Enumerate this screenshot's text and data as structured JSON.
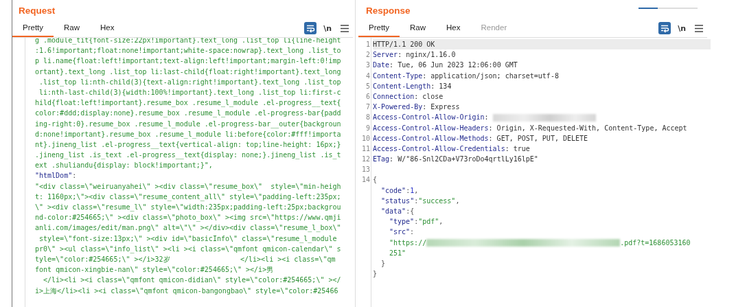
{
  "request": {
    "title": "Request",
    "tabs": [
      {
        "label": "Pretty",
        "selected": true,
        "disabled": false
      },
      {
        "label": "Raw",
        "selected": false,
        "disabled": false
      },
      {
        "label": "Hex",
        "selected": false,
        "disabled": false
      }
    ],
    "toolbar": [
      {
        "kind": "wrap",
        "selected": true
      },
      {
        "kind": "newline",
        "label": "\\n"
      },
      {
        "kind": "menu"
      }
    ],
    "rows": [
      {
        "segments": [
          {
            "kind": "string",
            "text": "g .module_tit{font-size:22px!important}.text_long .list_top li{line-height"
          }
        ]
      },
      {
        "segments": [
          {
            "kind": "string",
            "text": ":1.6!important;float:none!important;white-space:nowrap}.text_long .list_to"
          }
        ]
      },
      {
        "segments": [
          {
            "kind": "string",
            "text": "p li.name{float:left!important;text-align:left!important;margin-left:0!imp"
          }
        ]
      },
      {
        "segments": [
          {
            "kind": "string",
            "text": "ortant}.text_long .list_top li:last-child{float:right!important}.text_long"
          }
        ]
      },
      {
        "segments": [
          {
            "kind": "string",
            "text": " .list_top li:nth-child(3){text-align:right!important}.text_long .list_top"
          }
        ]
      },
      {
        "segments": [
          {
            "kind": "string",
            "text": " li:nth-last-child(3){width:100%!important}.text_long .list_top li:first-c"
          }
        ]
      },
      {
        "segments": [
          {
            "kind": "string",
            "text": "hild{float:left!important}.resume_box .resume_l_module .el-progress__text{"
          }
        ]
      },
      {
        "segments": [
          {
            "kind": "string",
            "text": "color:#ddd;display:none}.resume_box .resume_l_module .el-progress-bar{padd"
          }
        ]
      },
      {
        "segments": [
          {
            "kind": "string",
            "text": "ing-right:0}.resume_box .resume_l_module .el-progress-bar__outer{backgroun"
          }
        ]
      },
      {
        "segments": [
          {
            "kind": "string",
            "text": "d:none!important}.resume_box .resume_l_module li:before{color:#fff!importa"
          }
        ]
      },
      {
        "segments": [
          {
            "kind": "string",
            "text": "nt}.jineng_list .el-progress__text{vertical-align: top;line-height: 16px;}"
          }
        ]
      },
      {
        "segments": [
          {
            "kind": "string",
            "text": ".jineng_list .is_text .el-progress__text{display: none;}.jineng_list .is_t"
          }
        ]
      },
      {
        "segments": [
          {
            "kind": "string",
            "text": "ext .shuliandu{display: block!important;}\","
          }
        ]
      },
      {
        "segments": [
          {
            "kind": "key",
            "text": "\"htmlDom\""
          },
          {
            "kind": "punct",
            "text": ":"
          }
        ]
      },
      {
        "segments": [
          {
            "kind": "string",
            "text": "\"<div class=\\\"weiruanyahei\\\" ><div class=\\\"resume_box\\\"  style=\\\"min-heigh"
          }
        ]
      },
      {
        "segments": [
          {
            "kind": "string",
            "text": "t: 1160px;\\\"><div class=\\\"resume_content_all\\\" style=\\\"padding-left:235px;"
          }
        ]
      },
      {
        "segments": [
          {
            "kind": "string",
            "text": "\\\" ><div class=\\\"resume_l\\\" style=\\\"width:235px;padding-left:25px;backgrou"
          }
        ]
      },
      {
        "segments": [
          {
            "kind": "string",
            "text": "nd-color:#254665;\\\" ><div class=\\\"photo_box\\\" ><img src=\\\"https://www.qmji"
          }
        ]
      },
      {
        "segments": [
          {
            "kind": "string",
            "text": "anli.com/images/edit/man.png\\\" alt=\\\"\\\" ></div><div class=\\\"resume_l_box\\\""
          }
        ]
      },
      {
        "segments": [
          {
            "kind": "string",
            "text": " style=\\\"font-size:13px;\\\" ><div id=\\\"basicInfo\\\" class=\\\"resume_l_module"
          }
        ]
      },
      {
        "segments": [
          {
            "kind": "string",
            "text": "pr0\\\" ><ul class=\\\"info_list\\\" ><li ><i class=\\\"qmfont qmicon-calendar\\\" s"
          }
        ]
      },
      {
        "segments": [
          {
            "kind": "string",
            "text": "tyle=\\\"color:#254665;\\\" ></i>32岁                 </li><li ><i class=\\\"qm"
          }
        ]
      },
      {
        "segments": [
          {
            "kind": "string",
            "text": "font qmicon-xingbie-nan\\\" style=\\\"color:#254665;\\\" ></i>男"
          }
        ]
      },
      {
        "segments": [
          {
            "kind": "string",
            "text": "  </li><li ><i class=\\\"qmfont qmicon-didian\\\" style=\\\"color:#254665;\\\" ></"
          }
        ]
      },
      {
        "segments": [
          {
            "kind": "string",
            "text": "i>上海</li><li ><i class=\\\"qmfont qmicon-bangongbao\\\" style=\\\"color:#25466"
          }
        ]
      }
    ]
  },
  "response": {
    "title": "Response",
    "tabs": [
      {
        "label": "Pretty",
        "selected": true,
        "disabled": false
      },
      {
        "label": "Raw",
        "selected": false,
        "disabled": false
      },
      {
        "label": "Hex",
        "selected": false,
        "disabled": false
      },
      {
        "label": "Render",
        "selected": false,
        "disabled": true
      }
    ],
    "toolbar": [
      {
        "kind": "wrap",
        "selected": true
      },
      {
        "kind": "newline",
        "label": "\\n"
      },
      {
        "kind": "menu"
      }
    ],
    "rows": [
      {
        "number": "1",
        "current": true,
        "segments": [
          {
            "kind": "plain",
            "text": "HTTP/1.1 200 OK"
          }
        ]
      },
      {
        "number": "2",
        "current": false,
        "segments": [
          {
            "kind": "key",
            "text": "Server"
          },
          {
            "kind": "plain",
            "text": ": nginx/1.16.0"
          }
        ]
      },
      {
        "number": "3",
        "current": false,
        "segments": [
          {
            "kind": "key",
            "text": "Date"
          },
          {
            "kind": "plain",
            "text": ": Tue, 06 Jun 2023 12:06:00 GMT"
          }
        ]
      },
      {
        "number": "4",
        "current": false,
        "segments": [
          {
            "kind": "key",
            "text": "Content-Type"
          },
          {
            "kind": "plain",
            "text": ": application/json; charset=utf-8"
          }
        ]
      },
      {
        "number": "5",
        "current": false,
        "segments": [
          {
            "kind": "key",
            "text": "Content-Length"
          },
          {
            "kind": "plain",
            "text": ": 134"
          }
        ]
      },
      {
        "number": "6",
        "current": false,
        "segments": [
          {
            "kind": "key",
            "text": "Connection"
          },
          {
            "kind": "plain",
            "text": ": close"
          }
        ]
      },
      {
        "number": "7",
        "current": false,
        "segments": [
          {
            "kind": "key",
            "text": "X-Powered-By"
          },
          {
            "kind": "plain",
            "text": ": Express"
          }
        ]
      },
      {
        "number": "8",
        "current": false,
        "segments": [
          {
            "kind": "key",
            "text": "Access-Control-Allow-Origin"
          },
          {
            "kind": "plain",
            "text": ": "
          },
          {
            "kind": "redacted-plain"
          }
        ]
      },
      {
        "number": "9",
        "current": false,
        "segments": [
          {
            "kind": "key",
            "text": "Access-Control-Allow-Headers"
          },
          {
            "kind": "plain",
            "text": ": Origin, X-Requested-With, Content-Type, Accept"
          }
        ]
      },
      {
        "number": "10",
        "current": false,
        "segments": [
          {
            "kind": "key",
            "text": "Access-Control-Allow-Methods"
          },
          {
            "kind": "plain",
            "text": ": GET, POST, PUT, DELETE"
          }
        ]
      },
      {
        "number": "11",
        "current": false,
        "segments": [
          {
            "kind": "key",
            "text": "Access-Control-Allow-Credentials"
          },
          {
            "kind": "plain",
            "text": ": true"
          }
        ]
      },
      {
        "number": "12",
        "current": false,
        "segments": [
          {
            "kind": "key",
            "text": "ETag"
          },
          {
            "kind": "plain",
            "text": ": W/\"86-Snl2CDa+V73roDo4qrtlLy16lpE\""
          }
        ]
      },
      {
        "number": "13",
        "current": false,
        "segments": []
      },
      {
        "number": "14",
        "current": false,
        "segments": [
          {
            "kind": "punct",
            "text": "{"
          }
        ]
      },
      {
        "current": false,
        "kind": "inner",
        "segments": [
          {
            "kind": "key",
            "text": "\"code\""
          },
          {
            "kind": "punct",
            "text": ":"
          },
          {
            "kind": "number",
            "text": "1"
          },
          {
            "kind": "punct",
            "text": ","
          }
        ]
      },
      {
        "current": false,
        "kind": "inner",
        "segments": [
          {
            "kind": "key",
            "text": "\"status\""
          },
          {
            "kind": "punct",
            "text": ":"
          },
          {
            "kind": "string",
            "text": "\"success\""
          },
          {
            "kind": "punct",
            "text": ","
          }
        ]
      },
      {
        "current": false,
        "kind": "inner",
        "segments": [
          {
            "kind": "key",
            "text": "\"data\""
          },
          {
            "kind": "punct",
            "text": ":{"
          }
        ]
      },
      {
        "current": false,
        "kind": "deep",
        "segments": [
          {
            "kind": "key",
            "text": "\"type\""
          },
          {
            "kind": "punct",
            "text": ":"
          },
          {
            "kind": "string",
            "text": "\"pdf\""
          },
          {
            "kind": "punct",
            "text": ","
          }
        ]
      },
      {
        "current": false,
        "kind": "deep",
        "segments": [
          {
            "kind": "key",
            "text": "\"src\""
          },
          {
            "kind": "punct",
            "text": ":"
          }
        ]
      },
      {
        "current": false,
        "kind": "deep",
        "segments": [
          {
            "kind": "string",
            "text": "\"https://"
          },
          {
            "kind": "redacted-string"
          },
          {
            "kind": "string",
            "text": ".pdf?t=1686053160"
          }
        ]
      },
      {
        "current": false,
        "kind": "deep",
        "segments": [
          {
            "kind": "string",
            "text": "251\""
          }
        ]
      },
      {
        "current": false,
        "kind": "inner",
        "segments": [
          {
            "kind": "punct",
            "text": "}"
          }
        ]
      },
      {
        "current": false,
        "segments": [
          {
            "kind": "punct",
            "text": "}"
          }
        ]
      }
    ]
  }
}
